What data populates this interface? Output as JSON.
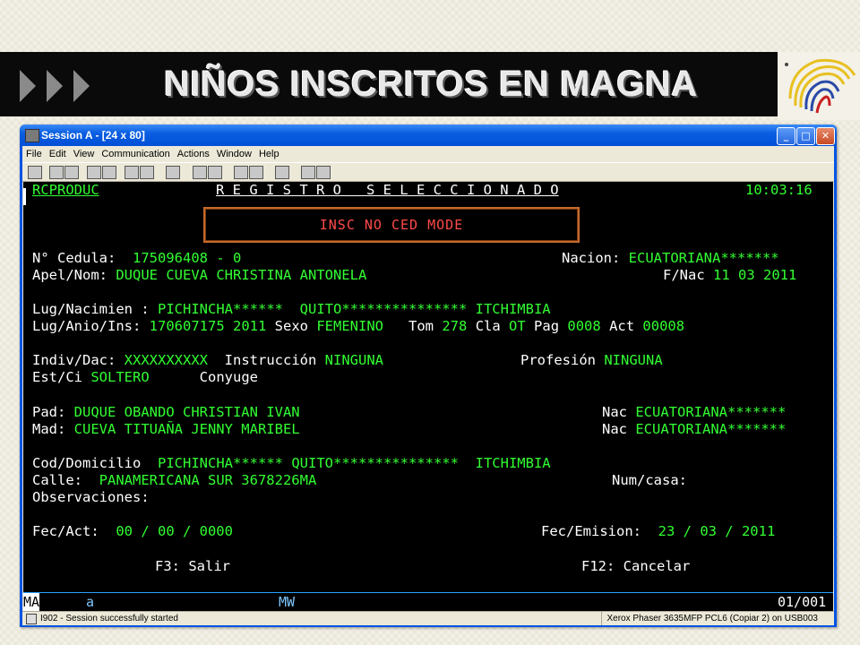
{
  "slide": {
    "title": "NIÑOS INSCRITOS EN MAGNA",
    "accent": "#0a0a0a"
  },
  "window": {
    "title": "Session A - [24 x 80]",
    "minimize_glyph": "_",
    "maximize_glyph": "□",
    "close_glyph": "✕"
  },
  "menu": [
    "File",
    "Edit",
    "View",
    "Communication",
    "Actions",
    "Window",
    "Help"
  ],
  "terminal": {
    "program": "RCPRODUC",
    "screen_title": "R E G I S T R O   S E L E C C I O N A D O",
    "time": "10:03:16",
    "mode": "INSC NO CED MODE",
    "cedula_label": "N° Cedula:",
    "cedula": "175096408 - 0",
    "nacion_label": "Nacion:",
    "nacion": "ECUATORIANA*******",
    "apel_label": "Apel/Nom:",
    "apel": "DUQUE CUEVA CHRISTINA ANTONELA",
    "fnac_label": "F/Nac",
    "fnac": "11 03 2011",
    "lugnac_label": "Lug/Nacimien :",
    "lugnac_prov": "PICHINCHA******",
    "lugnac_canton": "QUITO***************",
    "lugnac_parr": "ITCHIMBIA",
    "lugins_label": "Lug/Anio/Ins:",
    "lugins": "170607175 2011",
    "sexo_label": "Sexo",
    "sexo": "FEMENINO",
    "tom_label": "Tom",
    "tom": "278",
    "cla_label": "Cla",
    "cla": "OT",
    "pag_label": "Pag",
    "pag": "0008",
    "act_label": "Act",
    "act": "00008",
    "indiv_label": "Indiv/Dac:",
    "indiv": "XXXXXXXXXX",
    "instr_label": "Instrucción",
    "instr": "NINGUNA",
    "prof_label": "Profesión",
    "prof": "NINGUNA",
    "estci_label": "Est/Ci",
    "estci": "SOLTERO",
    "conyuge_label": "Conyuge",
    "pad_label": "Pad:",
    "pad": "DUQUE OBANDO CHRISTIAN IVAN",
    "pad_nac_label": "Nac",
    "pad_nac": "ECUATORIANA*******",
    "mad_label": "Mad:",
    "mad": "CUEVA TITUAÑA JENNY MARIBEL",
    "mad_nac_label": "Nac",
    "mad_nac": "ECUATORIANA*******",
    "cod_label": "Cod/Domicilio",
    "cod_prov": "PICHINCHA******",
    "cod_canton": "QUITO***************",
    "cod_parr": "ITCHIMBIA",
    "calle_label": "Calle:",
    "calle": "PANAMERICANA SUR 3678226MA",
    "numcasa_label": "Num/casa:",
    "obs_label": "Observaciones:",
    "fecact_label": "Fec/Act:",
    "fecact": "00 / 00 / 0000",
    "fecemi_label": "Fec/Emision:",
    "fecemi": "23 / 03 / 2011",
    "f3": "F3: Salir",
    "f12": "F12: Cancelar"
  },
  "oia": {
    "ma": "MA",
    "a": "a",
    "mw": "MW",
    "pos": "01/001"
  },
  "status": {
    "left": "I902 - Session successfully started",
    "right": "Xerox Phaser 3635MFP PCL6 (Copiar 2) on USB003"
  },
  "colors": {
    "terminal_green": "#32ff32",
    "terminal_red": "#ff4a4a",
    "title_blue": "#0054e3"
  }
}
